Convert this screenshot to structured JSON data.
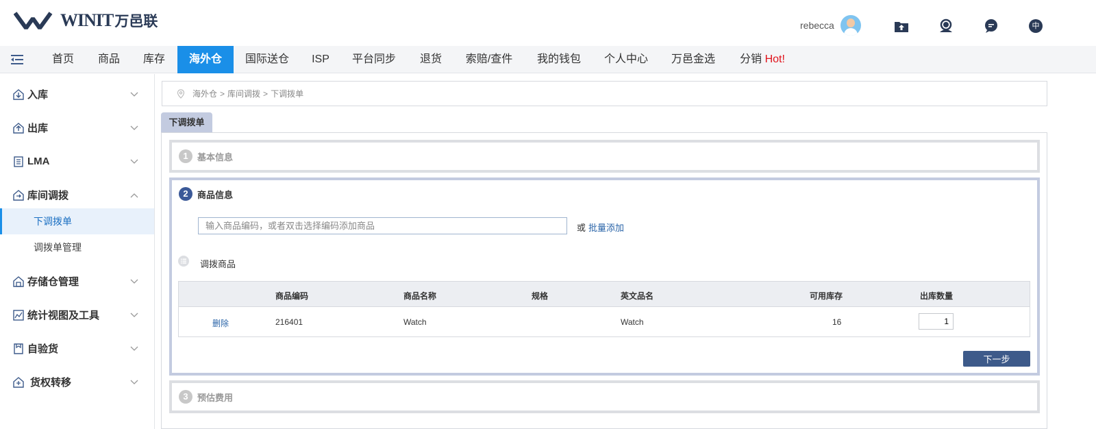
{
  "header": {
    "logo_text": "WINIT",
    "logo_cn": "万邑联",
    "username": "rebecca",
    "lang_label": "中"
  },
  "nav": {
    "items": [
      "首页",
      "商品",
      "库存",
      "海外仓",
      "国际送仓",
      "ISP",
      "平台同步",
      "退货",
      "索赔/查件",
      "我的钱包",
      "个人中心",
      "万邑金选",
      "分销"
    ],
    "hot_label": "Hot!",
    "active_index": 3
  },
  "sidebar": {
    "items": [
      {
        "label": "入库",
        "icon": "warehouse-in-icon",
        "expanded": false
      },
      {
        "label": "出库",
        "icon": "warehouse-out-icon",
        "expanded": false
      },
      {
        "label": "LMA",
        "icon": "document-icon",
        "expanded": false
      },
      {
        "label": "库间调拨",
        "icon": "warehouse-transfer-icon",
        "expanded": true
      },
      {
        "label": "存储仓管理",
        "icon": "storage-icon",
        "expanded": false
      },
      {
        "label": "统计视图及工具",
        "icon": "chart-icon",
        "expanded": false
      },
      {
        "label": "自验货",
        "icon": "inspect-icon",
        "expanded": false
      },
      {
        "label": "货权转移",
        "icon": "ownership-icon",
        "expanded": false
      }
    ],
    "sub_items": [
      "下调拨单",
      "调拨单管理"
    ]
  },
  "breadcrumb": [
    "海外仓",
    ">",
    "库间调拨",
    ">",
    "下调拨单"
  ],
  "page_tab": "下调拨单",
  "steps": [
    {
      "num": "1",
      "title": "基本信息"
    },
    {
      "num": "2",
      "title": "商品信息"
    },
    {
      "num": "3",
      "title": "预估费用"
    }
  ],
  "goods": {
    "input_placeholder": "输入商品编码，或者双击选择编码添加商品",
    "or_text": "或",
    "batch_add": "批量添加",
    "list_title": "调拨商品"
  },
  "table": {
    "headers": [
      "商品编码",
      "商品名称",
      "规格",
      "英文品名",
      "可用库存",
      "出库数量"
    ],
    "rows": [
      {
        "action": "删除",
        "code": "216401",
        "name": "Watch",
        "spec": "",
        "en_name": "Watch",
        "stock": "16",
        "qty": "1"
      }
    ]
  },
  "next_button": "下一步",
  "colors": {
    "nav_active": "#1a8fe8",
    "step_active_border": "#c3cbe0",
    "primary_button": "#3d5a8a",
    "link": "#2a64a8",
    "hot": "#e0121a"
  }
}
